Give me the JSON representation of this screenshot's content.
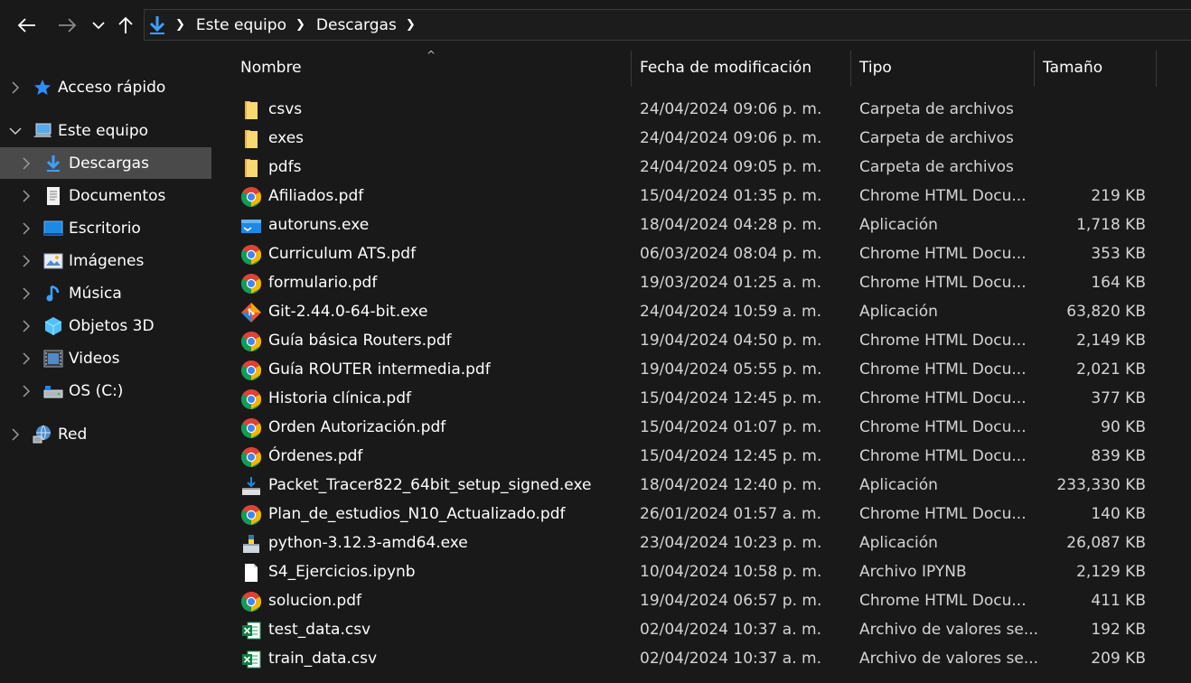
{
  "address": {
    "segments": [
      "Este equipo",
      "Descargas"
    ]
  },
  "sidebar": {
    "items": [
      {
        "label": "Acceso rápido",
        "icon": "star-icon",
        "level": 0,
        "expanded": false
      },
      {
        "label": "Este equipo",
        "icon": "computer-icon",
        "level": 0,
        "expanded": true
      },
      {
        "label": "Descargas",
        "icon": "download-icon",
        "level": 1,
        "expanded": false,
        "selected": true
      },
      {
        "label": "Documentos",
        "icon": "document-icon",
        "level": 1,
        "expanded": false
      },
      {
        "label": "Escritorio",
        "icon": "desktop-icon",
        "level": 1,
        "expanded": false
      },
      {
        "label": "Imágenes",
        "icon": "image-icon",
        "level": 1,
        "expanded": false
      },
      {
        "label": "Música",
        "icon": "music-icon",
        "level": 1,
        "expanded": false
      },
      {
        "label": "Objetos 3D",
        "icon": "cube-icon",
        "level": 1,
        "expanded": false
      },
      {
        "label": "Videos",
        "icon": "video-icon",
        "level": 1,
        "expanded": false
      },
      {
        "label": "OS (C:)",
        "icon": "drive-icon",
        "level": 1,
        "expanded": false
      },
      {
        "label": "Red",
        "icon": "network-icon",
        "level": 0,
        "expanded": false
      }
    ]
  },
  "columns": {
    "name": "Nombre",
    "date": "Fecha de modificación",
    "type": "Tipo",
    "size": "Tamaño"
  },
  "files": [
    {
      "name": "csvs",
      "date": "24/04/2024 09:06 p. m.",
      "type": "Carpeta de archivos",
      "size": "",
      "icon": "folder-icon"
    },
    {
      "name": "exes",
      "date": "24/04/2024 09:06 p. m.",
      "type": "Carpeta de archivos",
      "size": "",
      "icon": "folder-icon"
    },
    {
      "name": "pdfs",
      "date": "24/04/2024 09:05 p. m.",
      "type": "Carpeta de archivos",
      "size": "",
      "icon": "folder-icon"
    },
    {
      "name": "Afiliados.pdf",
      "date": "15/04/2024 01:35 p. m.",
      "type": "Chrome HTML Docu...",
      "size": "219 KB",
      "icon": "chrome-icon"
    },
    {
      "name": "autoruns.exe",
      "date": "18/04/2024 04:28 p. m.",
      "type": "Aplicación",
      "size": "1,718 KB",
      "icon": "app-window-icon"
    },
    {
      "name": "Curriculum ATS.pdf",
      "date": "06/03/2024 08:04 p. m.",
      "type": "Chrome HTML Docu...",
      "size": "353 KB",
      "icon": "chrome-icon"
    },
    {
      "name": "formulario.pdf",
      "date": "19/03/2024 01:25 a. m.",
      "type": "Chrome HTML Docu...",
      "size": "164 KB",
      "icon": "chrome-icon"
    },
    {
      "name": "Git-2.44.0-64-bit.exe",
      "date": "24/04/2024 10:59 a. m.",
      "type": "Aplicación",
      "size": "63,820 KB",
      "icon": "git-icon"
    },
    {
      "name": "Guía básica Routers.pdf",
      "date": "19/04/2024 04:50 p. m.",
      "type": "Chrome HTML Docu...",
      "size": "2,149 KB",
      "icon": "chrome-icon"
    },
    {
      "name": "Guía ROUTER intermedia.pdf",
      "date": "19/04/2024 05:55 p. m.",
      "type": "Chrome HTML Docu...",
      "size": "2,021 KB",
      "icon": "chrome-icon"
    },
    {
      "name": "Historia clínica.pdf",
      "date": "15/04/2024 12:45 p. m.",
      "type": "Chrome HTML Docu...",
      "size": "377 KB",
      "icon": "chrome-icon"
    },
    {
      "name": "Orden Autorización.pdf",
      "date": "15/04/2024 01:07 p. m.",
      "type": "Chrome HTML Docu...",
      "size": "90 KB",
      "icon": "chrome-icon"
    },
    {
      "name": "Órdenes.pdf",
      "date": "15/04/2024 12:45 p. m.",
      "type": "Chrome HTML Docu...",
      "size": "839 KB",
      "icon": "chrome-icon"
    },
    {
      "name": "Packet_Tracer822_64bit_setup_signed.exe",
      "date": "18/04/2024 12:40 p. m.",
      "type": "Aplicación",
      "size": "233,330 KB",
      "icon": "installer-icon"
    },
    {
      "name": "Plan_de_estudios_N10_Actualizado.pdf",
      "date": "26/01/2024 01:57 a. m.",
      "type": "Chrome HTML Docu...",
      "size": "140 KB",
      "icon": "chrome-icon"
    },
    {
      "name": "python-3.12.3-amd64.exe",
      "date": "23/04/2024 10:23 p. m.",
      "type": "Aplicación",
      "size": "26,087 KB",
      "icon": "python-installer-icon"
    },
    {
      "name": "S4_Ejercicios.ipynb",
      "date": "10/04/2024 10:58 p. m.",
      "type": "Archivo IPYNB",
      "size": "2,129 KB",
      "icon": "blank-file-icon"
    },
    {
      "name": "solucion.pdf",
      "date": "19/04/2024 06:57 p. m.",
      "type": "Chrome HTML Docu...",
      "size": "411 KB",
      "icon": "chrome-icon"
    },
    {
      "name": "test_data.csv",
      "date": "02/04/2024 10:37 a. m.",
      "type": "Archivo de valores se...",
      "size": "192 KB",
      "icon": "excel-icon"
    },
    {
      "name": "train_data.csv",
      "date": "02/04/2024 10:37 a. m.",
      "type": "Archivo de valores se...",
      "size": "209 KB",
      "icon": "excel-icon"
    }
  ]
}
